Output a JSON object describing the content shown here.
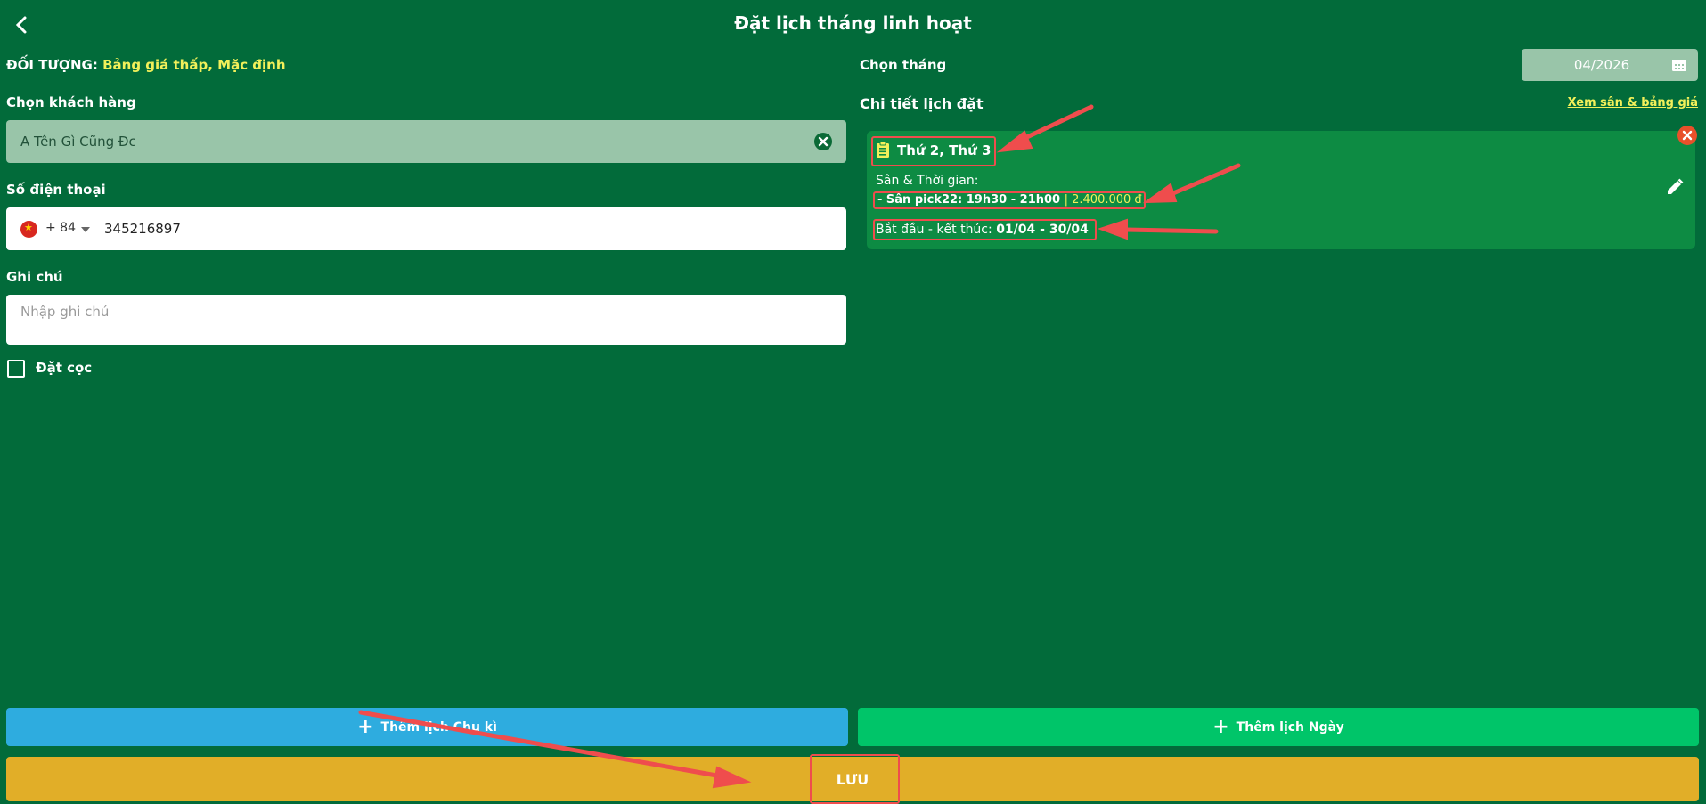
{
  "header": {
    "title": "Đặt lịch tháng linh hoạt",
    "back_icon": "chevron-left-icon"
  },
  "audience": {
    "label": "ĐỐI TƯỢNG:",
    "value": "Bảng giá thấp, Mặc định"
  },
  "customer": {
    "label": "Chọn khách hàng",
    "value": "A Tên Gì Cũng Đc"
  },
  "phone": {
    "label": "Số điện thoại",
    "prefix": "+ 84",
    "value": "345216897"
  },
  "note": {
    "label": "Ghi chú",
    "placeholder": "Nhập ghi chú"
  },
  "deposit": {
    "label": "Đặt cọc",
    "checked": false
  },
  "month": {
    "label": "Chọn tháng",
    "value": "04/2026"
  },
  "details": {
    "label": "Chi tiết lịch đặt",
    "view_link": "Xem sân & bảng giá",
    "card": {
      "days": "Thứ 2, Thứ 3",
      "court_label": "Sân & Thời gian:",
      "court_line": "- Sân pick22: 19h30 - 21h00",
      "price": "| 2.400.000 đ",
      "range_label": "Bắt đầu - kết thúc:",
      "range_value": "01/04 - 30/04"
    }
  },
  "buttons": {
    "add_cycle": "Thêm lịch Chu kì",
    "add_day": "Thêm lịch Ngày",
    "save": "LƯU"
  },
  "colors": {
    "background": "#026b3a",
    "card": "#0d8b43",
    "highlight_text": "#f2f05a",
    "btn_cycle": "#2eacdf",
    "btn_day": "#00c569",
    "btn_save": "#e1ae28",
    "annotation": "#ef4d4d"
  }
}
